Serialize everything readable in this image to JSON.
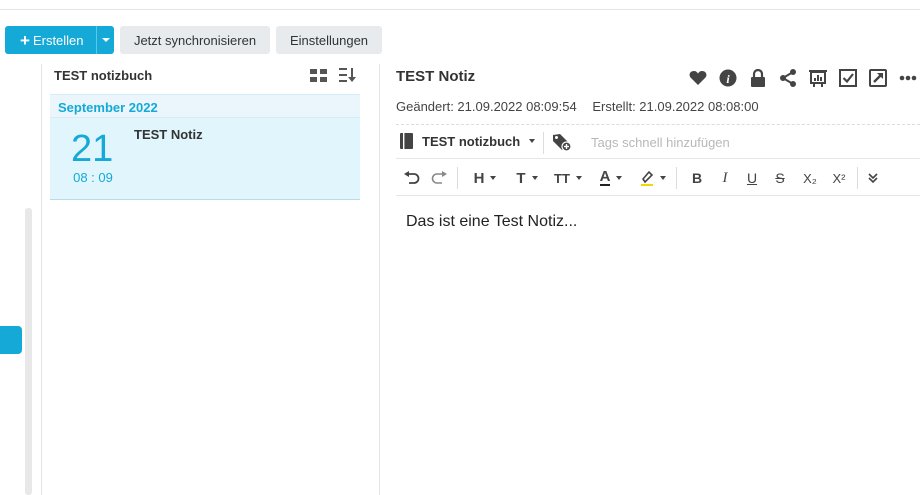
{
  "toolbar": {
    "create_label": "Erstellen",
    "sync_label": "Jetzt synchronisieren",
    "settings_label": "Einstellungen",
    "accent_color": "#15a9d8"
  },
  "notes_list": {
    "notebook_title": "TEST notizbuch",
    "view_icon": "grid-icon",
    "sort_icon": "sort-icon",
    "month_label": "September 2022",
    "notes": [
      {
        "day": "21",
        "time": "08 : 09",
        "title": "TEST Notiz"
      }
    ]
  },
  "editor": {
    "title": "TEST Notiz",
    "modified": "Geändert: 21.09.2022 08:09:54",
    "created": "Erstellt: 21.09.2022 08:08:00",
    "notebook": "TEST notizbuch",
    "tags_placeholder": "Tags schnell hinzufügen",
    "actions": [
      "heart-icon",
      "info-icon",
      "lock-icon",
      "share-icon",
      "presentation-icon",
      "checkbox-icon",
      "external-icon",
      "more-icon"
    ],
    "format_bar": {
      "heading": "H",
      "font": "T",
      "size": "TT",
      "color": "A",
      "bold": "B",
      "italic": "I",
      "underline": "U",
      "strike": "S",
      "subscript": "X₂",
      "superscript": "X²"
    },
    "content": "Das ist eine Test Notiz..."
  }
}
